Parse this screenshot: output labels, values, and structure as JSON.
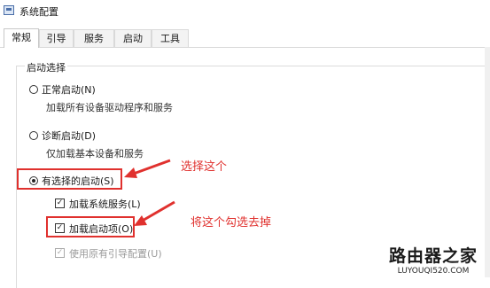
{
  "window": {
    "title": "系统配置"
  },
  "tabs": [
    {
      "label": "常规",
      "active": true
    },
    {
      "label": "引导"
    },
    {
      "label": "服务"
    },
    {
      "label": "启动"
    },
    {
      "label": "工具"
    }
  ],
  "startup": {
    "group_label": "启动选择",
    "normal": {
      "label": "正常启动(N)",
      "desc": "加载所有设备驱动程序和服务",
      "checked": false
    },
    "diagnostic": {
      "label": "诊断启动(D)",
      "desc": "仅加载基本设备和服务",
      "checked": false
    },
    "selective": {
      "label": "有选择的启动(S)",
      "checked": true
    },
    "load_services": {
      "label": "加载系统服务(L)",
      "checked": true
    },
    "load_startup": {
      "label": "加载启动项(O)",
      "checked": true
    },
    "use_original": {
      "label": "使用原有引导配置(U)",
      "checked": true,
      "disabled": true
    }
  },
  "annotations": {
    "select_this": "选择这个",
    "uncheck_this": "将这个勾选去掉",
    "color": "#e0312e"
  },
  "watermark": {
    "name": "路由器之家",
    "url": "LUYOUQI520.COM"
  }
}
